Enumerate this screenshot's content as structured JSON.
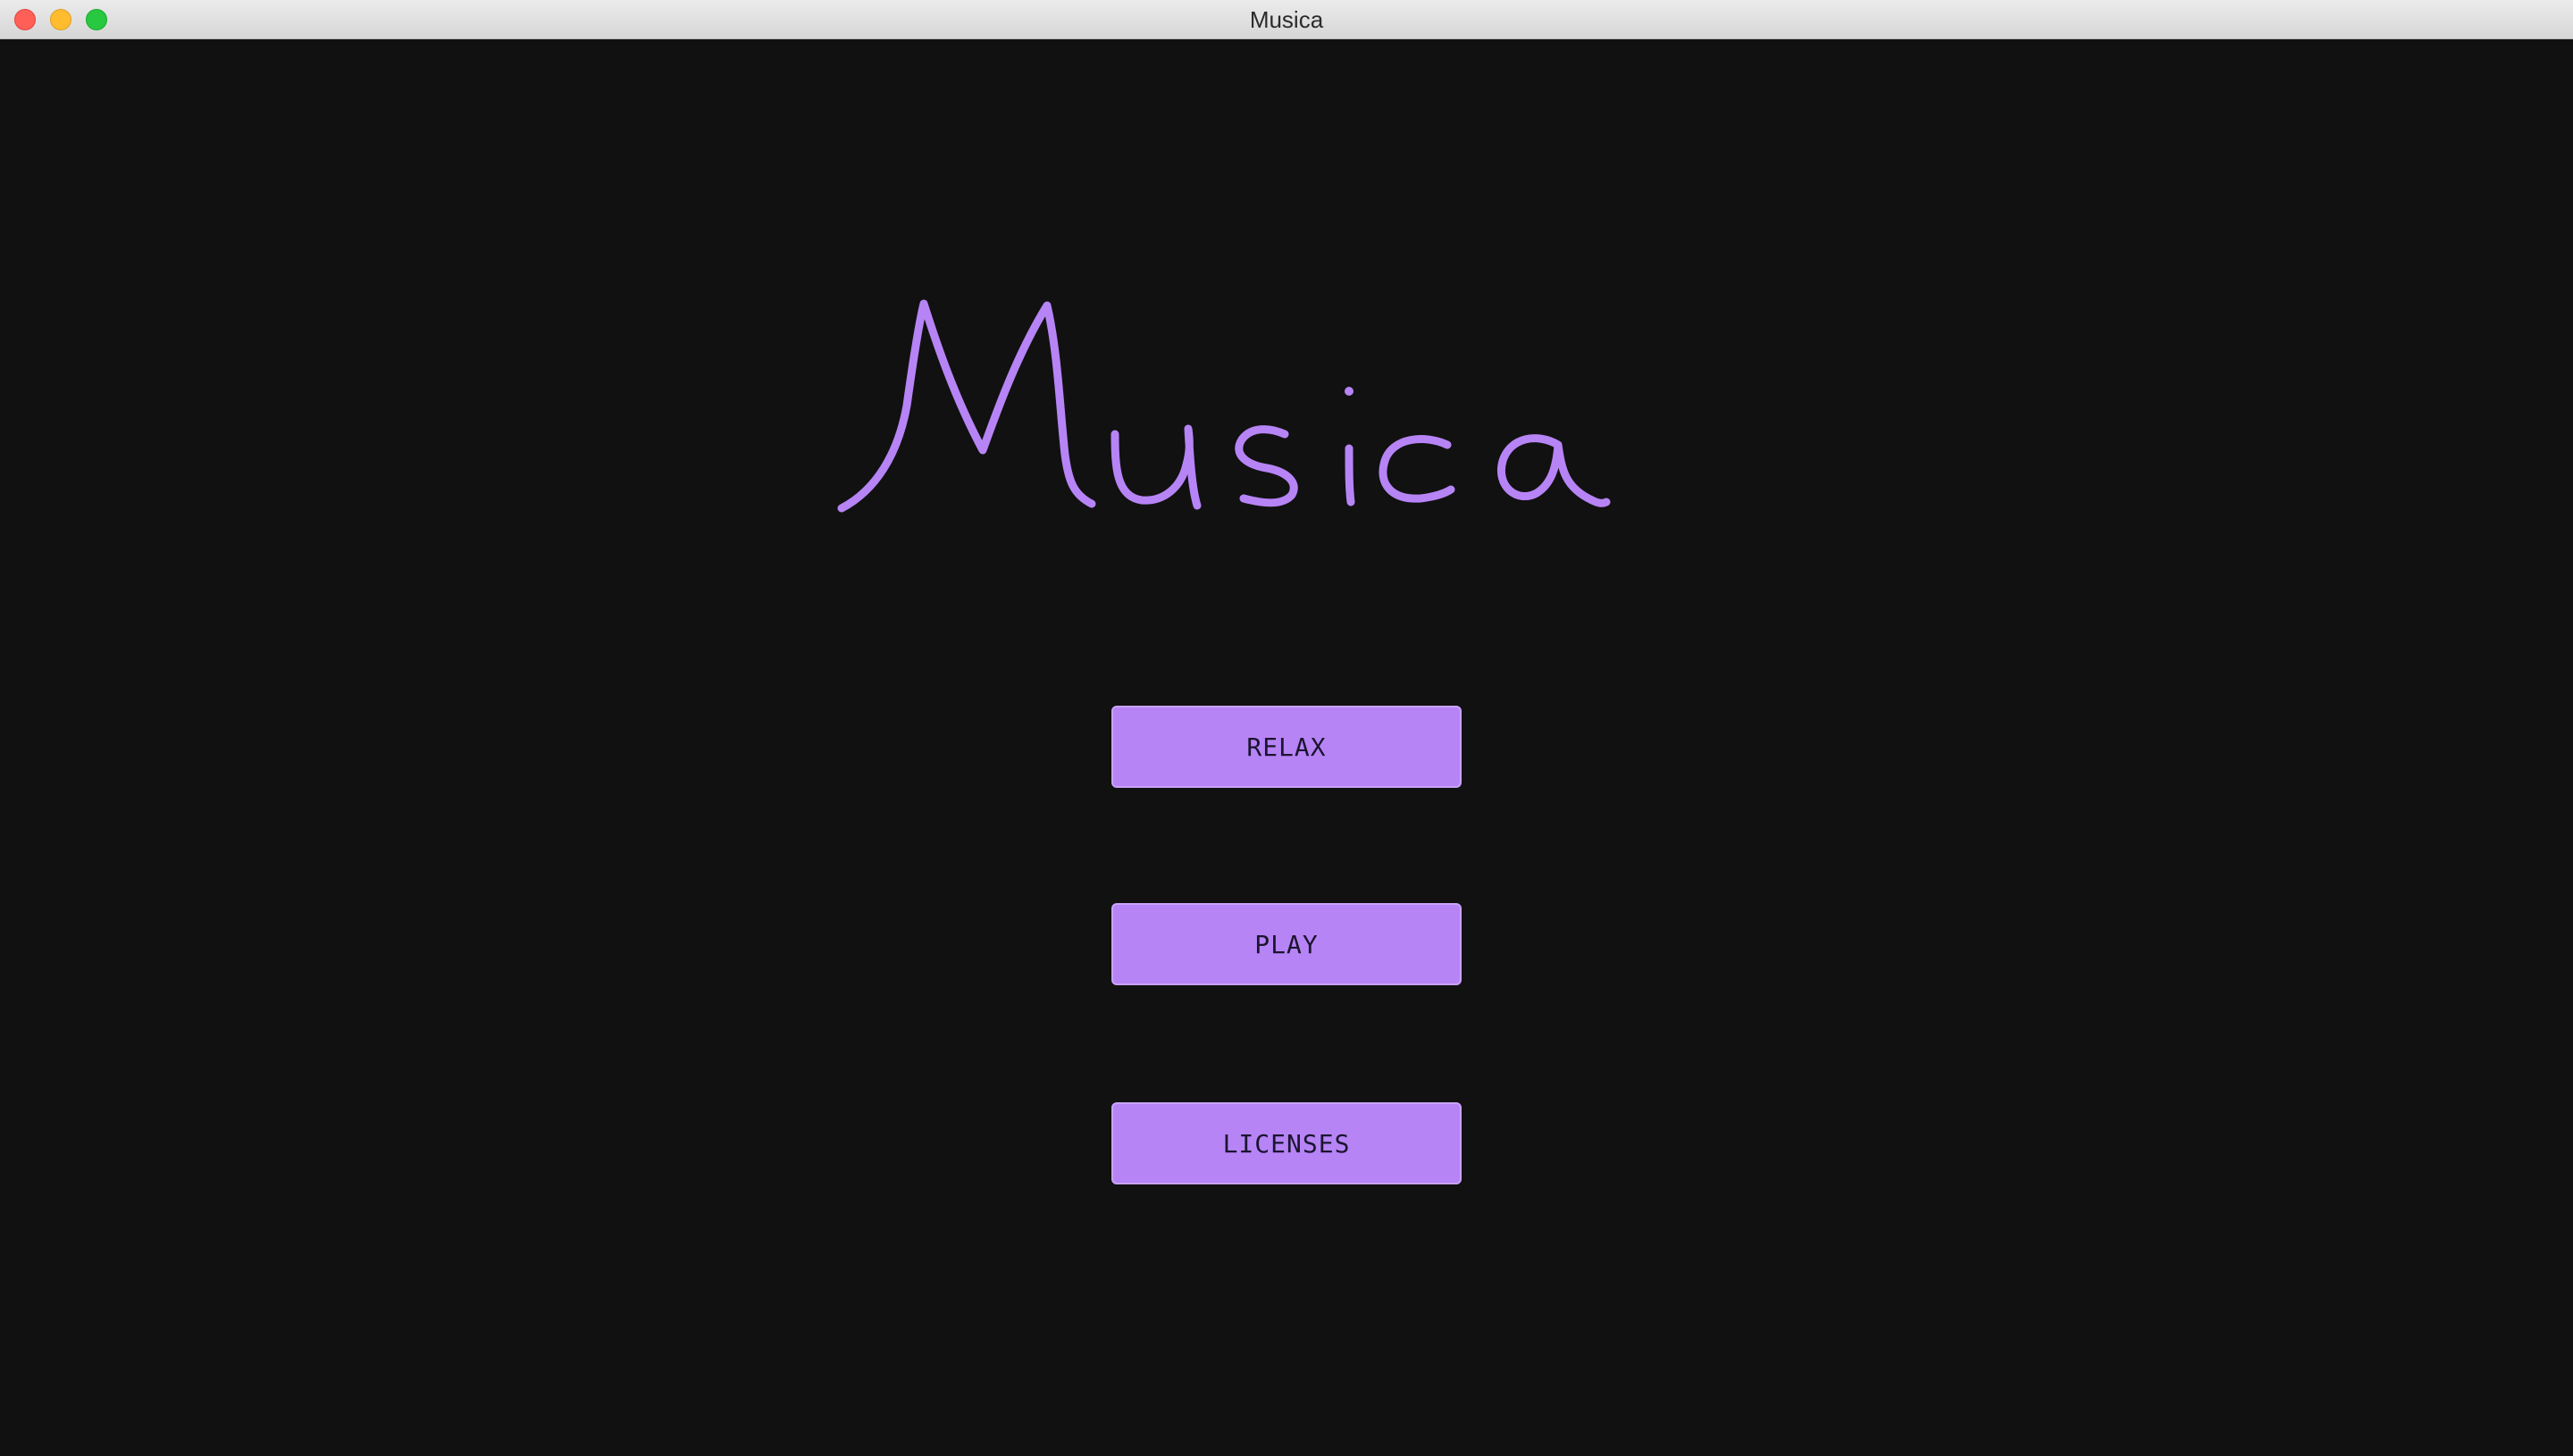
{
  "window": {
    "title": "Musica"
  },
  "logo": {
    "text": "Musica",
    "color": "#b784f6",
    "style": "handwritten"
  },
  "menu": {
    "buttons": [
      {
        "label": "RELAX"
      },
      {
        "label": "PLAY"
      },
      {
        "label": "LICENSES"
      }
    ],
    "button_color": "#b784f6",
    "background_color": "#111111"
  }
}
